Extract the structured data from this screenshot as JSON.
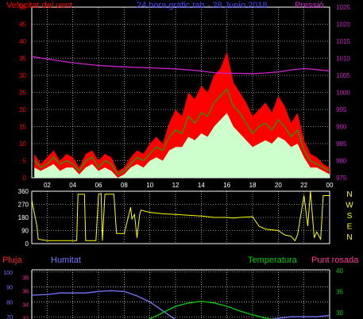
{
  "panel1": {
    "title_left": "Velocitat del vent",
    "title_center": "24 hora gràfic tab - 28 Junio 2018",
    "title_right": "Pressió"
  },
  "panel2": {
    "cardinals": [
      "N",
      "W",
      "S",
      "E",
      "N"
    ]
  },
  "panel3": {
    "legend_left1": "Pluja",
    "legend_left2": "Humitat",
    "legend_right1": "Temperatura",
    "legend_right2": "Punt rosada"
  },
  "colors": {
    "bg": "#000000",
    "grid": "#ffffff",
    "wind_gust": "#ff0000",
    "wind_speed": "#00b000",
    "wind_avg": "#ccffcc",
    "pressure": "#cc22cc",
    "direction": "#ffff00",
    "humidity": "#7777ff",
    "temperature": "#00cc00",
    "dew_point": "#ff3399",
    "rain": "#ff2222"
  },
  "chart_data": [
    {
      "type": "line",
      "name": "wind-and-pressure",
      "x_ticks": [
        "02",
        "04",
        "06",
        "08",
        "10",
        "12",
        "14",
        "16",
        "18",
        "20",
        "22",
        "00"
      ],
      "x_range": [
        0.8,
        24.0
      ],
      "y_left": {
        "ticks": [
          0,
          5,
          10,
          15,
          20,
          25,
          30,
          35,
          40,
          45,
          50
        ],
        "range": [
          0,
          50
        ]
      },
      "y_right": {
        "ticks": [
          975,
          980,
          985,
          990,
          995,
          1000,
          1005,
          1010,
          1015,
          1020,
          1025
        ],
        "range": [
          975,
          1025
        ]
      },
      "series": [
        {
          "role": "gust",
          "axis": "left",
          "x": [
            1,
            1.5,
            2,
            2.5,
            3,
            3.5,
            4,
            4.5,
            5,
            5.5,
            6,
            6.5,
            7,
            7.5,
            8,
            8.5,
            9,
            9.5,
            10,
            10.5,
            11,
            11.5,
            12,
            12.5,
            13,
            13.5,
            14,
            14.5,
            15,
            15.5,
            16,
            16.5,
            17,
            17.5,
            18,
            18.5,
            19,
            19.5,
            20,
            20.5,
            21,
            21.5,
            22,
            22.5,
            23,
            23.5,
            24
          ],
          "y": [
            7,
            4,
            6,
            8,
            5,
            7,
            6,
            3,
            7,
            8,
            5,
            7,
            6,
            2,
            3,
            6,
            8,
            7,
            10,
            12,
            10,
            16,
            20,
            18,
            25,
            23,
            27,
            25,
            30,
            32,
            37,
            28,
            25,
            22,
            18,
            20,
            22,
            19,
            24,
            21,
            16,
            19,
            11,
            7,
            6,
            4,
            3
          ]
        },
        {
          "role": "speed",
          "axis": "left",
          "x": [
            1,
            1.5,
            2,
            2.5,
            3,
            3.5,
            4,
            4.5,
            5,
            5.5,
            6,
            6.5,
            7,
            7.5,
            8,
            8.5,
            9,
            9.5,
            10,
            10.5,
            11,
            11.5,
            12,
            12.5,
            13,
            13.5,
            14,
            14.5,
            15,
            15.5,
            16,
            16.5,
            17,
            17.5,
            18,
            18.5,
            19,
            19.5,
            20,
            20.5,
            21,
            21.5,
            22,
            22.5,
            23,
            23.5,
            24
          ],
          "y": [
            5,
            3,
            4,
            6,
            4,
            5,
            4,
            2,
            5,
            6,
            3,
            5,
            4,
            1,
            2,
            4,
            6,
            5,
            7,
            9,
            8,
            12,
            14,
            13,
            18,
            16,
            19,
            18,
            22,
            24,
            26,
            21,
            19,
            16,
            13,
            15,
            16,
            14,
            17,
            15,
            12,
            14,
            8,
            5,
            4,
            3,
            2
          ]
        },
        {
          "role": "average",
          "axis": "left",
          "x": [
            1,
            1.5,
            2,
            2.5,
            3,
            3.5,
            4,
            4.5,
            5,
            5.5,
            6,
            6.5,
            7,
            7.5,
            8,
            8.5,
            9,
            9.5,
            10,
            10.5,
            11,
            11.5,
            12,
            12.5,
            13,
            13.5,
            14,
            14.5,
            15,
            15.5,
            16,
            16.5,
            17,
            17.5,
            18,
            18.5,
            19,
            19.5,
            20,
            20.5,
            21,
            21.5,
            22,
            22.5,
            23,
            23.5,
            24
          ],
          "y": [
            3,
            2,
            3,
            4,
            2,
            3,
            3,
            1,
            3,
            4,
            2,
            3,
            2,
            0,
            1,
            3,
            4,
            3,
            5,
            6,
            5,
            8,
            9,
            9,
            12,
            11,
            13,
            12,
            15,
            17,
            19,
            15,
            13,
            11,
            9,
            10,
            11,
            10,
            12,
            11,
            9,
            10,
            6,
            3,
            3,
            2,
            1
          ]
        },
        {
          "role": "pressure",
          "axis": "right",
          "x": [
            0.8,
            2,
            4,
            6,
            8,
            10,
            12,
            14,
            15,
            16,
            17,
            18,
            19,
            20,
            21,
            22,
            23,
            24
          ],
          "y": [
            1010.5,
            1009.8,
            1008.7,
            1007.9,
            1007.5,
            1007.2,
            1006.9,
            1006.3,
            1005.8,
            1005.6,
            1005.6,
            1005.5,
            1005.7,
            1006,
            1006.6,
            1007,
            1006.7,
            1006.3
          ]
        }
      ]
    },
    {
      "type": "line",
      "name": "wind-direction",
      "y_ticks": [
        0,
        90,
        180,
        270,
        360
      ],
      "y_range": [
        0,
        360
      ],
      "series": [
        {
          "role": "direction",
          "x": [
            0.8,
            1.2,
            1.3,
            2,
            3,
            4,
            4.3,
            4.4,
            4.9,
            5,
            5.8,
            6.0,
            6.2,
            6.3,
            6.5,
            7.2,
            7.4,
            8.0,
            8.5,
            8.6,
            8.8,
            9.0,
            9.2,
            9.3,
            10,
            11,
            12,
            13,
            14,
            15,
            16,
            16.5,
            17,
            18,
            18.5,
            19,
            20,
            20.5,
            21,
            21.3,
            21.5,
            22,
            22.3,
            22.5,
            22.8,
            23,
            23.3,
            23.5,
            24
          ],
          "y": [
            300,
            120,
            30,
            20,
            20,
            20,
            20,
            340,
            340,
            20,
            20,
            340,
            345,
            20,
            340,
            340,
            70,
            70,
            250,
            170,
            200,
            40,
            200,
            230,
            215,
            205,
            200,
            195,
            190,
            180,
            180,
            175,
            180,
            185,
            120,
            100,
            90,
            60,
            50,
            20,
            60,
            330,
            120,
            360,
            40,
            80,
            30,
            330,
            330
          ]
        }
      ]
    },
    {
      "type": "line",
      "name": "humidity-temperature",
      "y_left": {
        "ticks": [
          70,
          80,
          90,
          100
        ],
        "range": [
          68,
          101
        ]
      },
      "y_left2": {
        "ticks": [
          32,
          34,
          36,
          38
        ],
        "range": [
          31.7,
          39
        ]
      },
      "y_right": {
        "ticks": [
          30,
          35,
          40
        ],
        "range": [
          28.3,
          40
        ]
      },
      "series": [
        {
          "role": "humidity",
          "axis": "left",
          "x": [
            0.8,
            2,
            3,
            4,
            5,
            6,
            7,
            8,
            9,
            10,
            11,
            12,
            13,
            14,
            15,
            16,
            17,
            18,
            19,
            20,
            21,
            22,
            23,
            24
          ],
          "y": [
            84.5,
            85,
            86,
            86,
            86,
            87,
            87.5,
            87,
            84,
            80,
            74,
            68,
            68,
            68,
            68,
            68,
            68,
            68,
            68,
            69,
            70,
            70,
            70,
            71
          ]
        },
        {
          "role": "temperature",
          "axis": "right",
          "x": [
            9,
            10,
            11,
            12,
            13,
            14,
            15,
            16,
            17,
            18,
            19,
            20,
            21
          ],
          "y": [
            27.5,
            28.5,
            30,
            31.5,
            32.3,
            32.7,
            32.3,
            31.5,
            30.4,
            29.5,
            28.7,
            28.2,
            28
          ]
        }
      ]
    }
  ]
}
